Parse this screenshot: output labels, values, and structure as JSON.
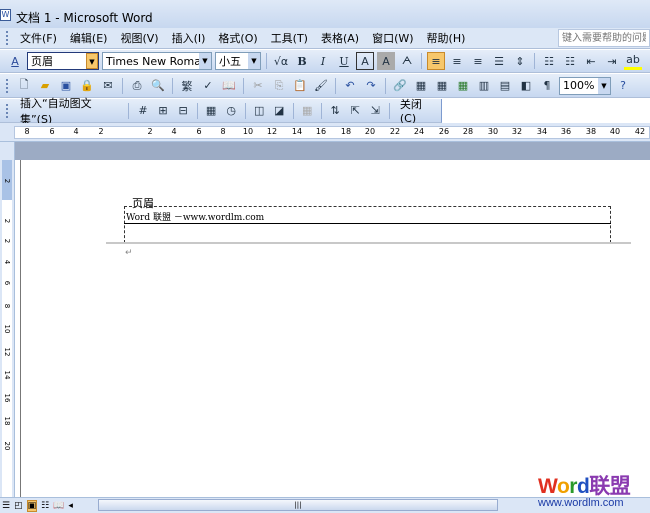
{
  "window": {
    "title": "文档 1 - Microsoft Word"
  },
  "menu": [
    "文件(F)",
    "编辑(E)",
    "视图(V)",
    "插入(I)",
    "格式(O)",
    "工具(T)",
    "表格(A)",
    "窗口(W)",
    "帮助(H)"
  ],
  "help_placeholder": "键入需要帮助的问题",
  "format": {
    "style": "页眉",
    "font": "Times New Roman",
    "size": "小五",
    "zoom": "100%"
  },
  "hf_toolbar": {
    "insert_autotext": "插入“自动图文集”(S)",
    "close": "关闭(C)"
  },
  "ruler": {
    "h": [
      "8",
      "6",
      "4",
      "2",
      "2",
      "4",
      "6",
      "8",
      "10",
      "12",
      "14",
      "16",
      "18",
      "20",
      "22",
      "24",
      "26",
      "28",
      "30",
      "32",
      "34",
      "36",
      "38",
      "40",
      "42"
    ],
    "v": [
      "2",
      "2",
      "2",
      "4",
      "6",
      "8",
      "10",
      "12",
      "14",
      "16",
      "18",
      "20"
    ]
  },
  "document": {
    "header_label": "页眉",
    "header_text": "Word 联盟 －www.wordlm.com",
    "para_mark": "↵"
  },
  "watermark": {
    "line1": "Word联盟",
    "line2": "www.wordlm.com"
  }
}
